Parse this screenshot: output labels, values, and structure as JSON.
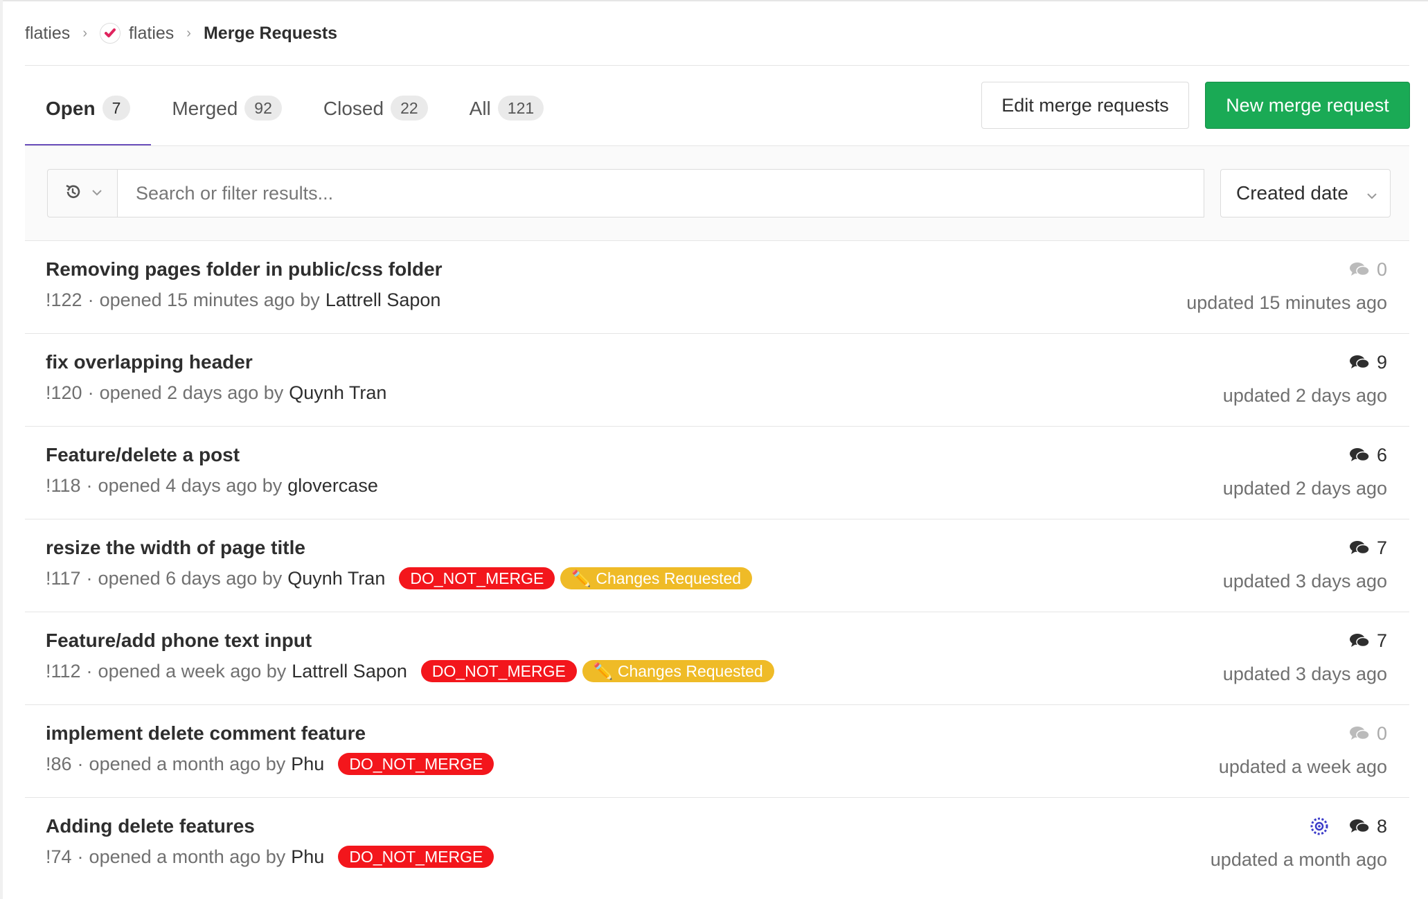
{
  "breadcrumb": {
    "group": "flaties",
    "project": "flaties",
    "current": "Merge Requests"
  },
  "tabs": [
    {
      "label": "Open",
      "count": "7"
    },
    {
      "label": "Merged",
      "count": "92"
    },
    {
      "label": "Closed",
      "count": "22"
    },
    {
      "label": "All",
      "count": "121"
    }
  ],
  "actions": {
    "edit_label": "Edit merge requests",
    "new_label": "New merge request"
  },
  "filter": {
    "placeholder": "Search or filter results...",
    "sort_label": "Created date"
  },
  "colors": {
    "accent": "#6b4fbb",
    "green": "#1aaa55",
    "red_label": "#f3161c",
    "yellow_label": "#efbb27"
  },
  "merge_requests": [
    {
      "title": "Removing pages folder in public/css folder",
      "iid": "!122",
      "opened": "opened 15 minutes ago by",
      "author": "Lattrell Sapon",
      "comments": "0",
      "updated": "updated 15 minutes ago"
    },
    {
      "title": "fix overlapping header",
      "iid": "!120",
      "opened": "opened 2 days ago by",
      "author": "Quynh Tran",
      "comments": "9",
      "updated": "updated 2 days ago"
    },
    {
      "title": "Feature/delete a post",
      "iid": "!118",
      "opened": "opened 4 days ago by",
      "author": "glovercase",
      "comments": "6",
      "updated": "updated 2 days ago"
    },
    {
      "title": "resize the width of page title",
      "iid": "!117",
      "opened": "opened 6 days ago by",
      "author": "Quynh Tran",
      "labels": [
        "DO_NOT_MERGE",
        "✏️ Changes Requested"
      ],
      "comments": "7",
      "updated": "updated 3 days ago"
    },
    {
      "title": "Feature/add phone text input",
      "iid": "!112",
      "opened": "opened a week ago by",
      "author": "Lattrell Sapon",
      "labels": [
        "DO_NOT_MERGE",
        "✏️ Changes Requested"
      ],
      "comments": "7",
      "updated": "updated 3 days ago"
    },
    {
      "title": "implement delete comment feature",
      "iid": "!86",
      "opened": "opened a month ago by",
      "author": "Phu",
      "labels": [
        "DO_NOT_MERGE"
      ],
      "comments": "0",
      "updated": "updated a week ago"
    },
    {
      "title": "Adding delete features",
      "iid": "!74",
      "opened": "opened a month ago by",
      "author": "Phu",
      "labels": [
        "DO_NOT_MERGE"
      ],
      "comments": "8",
      "updated": "updated a month ago"
    }
  ]
}
